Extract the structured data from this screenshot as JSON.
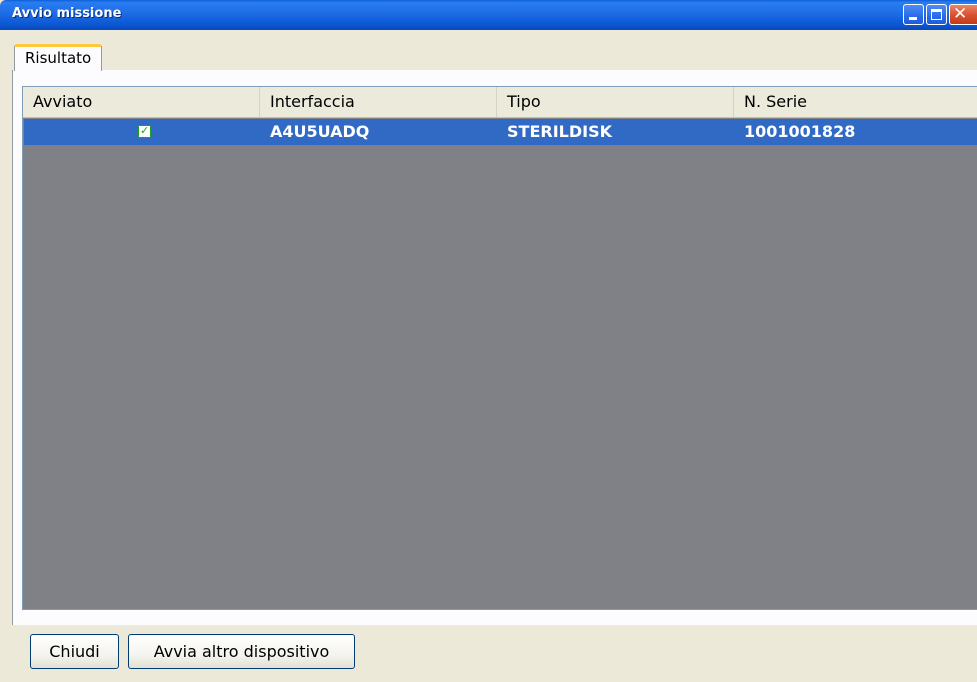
{
  "window": {
    "title": "Avvio missione",
    "controls": {
      "minimize": "minimize-icon",
      "maximize": "maximize-icon",
      "close": "close-icon"
    }
  },
  "tabs": [
    {
      "label": "Risultato",
      "active": true
    }
  ],
  "table": {
    "columns": [
      "Avviato",
      "Interfaccia",
      "Tipo",
      "N. Serie"
    ],
    "rows": [
      {
        "avviato": true,
        "interfaccia": "A4U5UADQ",
        "tipo": "STERILDISK",
        "serie": "1001001828",
        "selected": true
      }
    ]
  },
  "buttons": {
    "close_label": "Chiudi",
    "start_other_label": "Avvia altro dispositivo"
  },
  "colors": {
    "selection": "#316ac5",
    "empty_area": "#808087",
    "titlebar": "#0a55d1",
    "tab_accent": "#ffc73c"
  }
}
